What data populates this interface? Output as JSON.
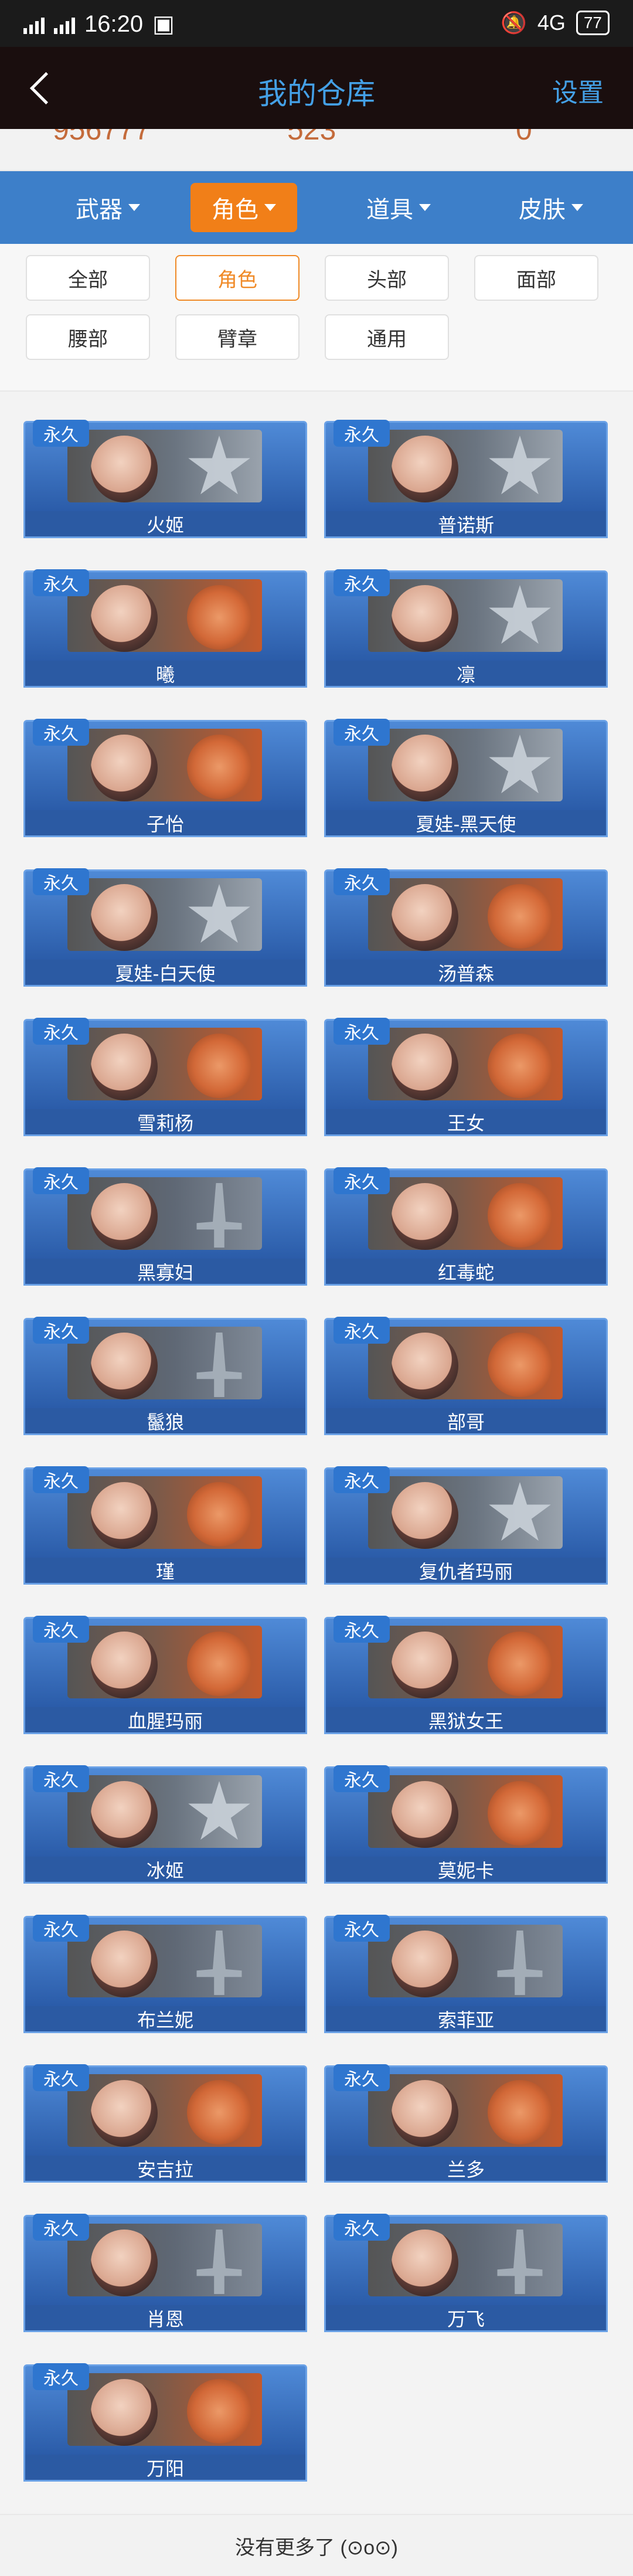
{
  "status": {
    "time": "16:20",
    "left_icons": [
      "signal-icon",
      "network-icon",
      "notification-icon"
    ],
    "right_text": "4G",
    "battery": "77"
  },
  "nav": {
    "title": "我的仓库",
    "settings": "设置"
  },
  "partial_header": {
    "values": [
      "956777",
      "523",
      "0"
    ]
  },
  "tabs": [
    {
      "label": "武器",
      "active": false
    },
    {
      "label": "角色",
      "active": true
    },
    {
      "label": "道具",
      "active": false
    },
    {
      "label": "皮肤",
      "active": false
    }
  ],
  "filters": [
    {
      "label": "全部",
      "active": false
    },
    {
      "label": "角色",
      "active": true
    },
    {
      "label": "头部",
      "active": false
    },
    {
      "label": "面部",
      "active": false
    },
    {
      "label": "腰部",
      "active": false
    },
    {
      "label": "臂章",
      "active": false
    },
    {
      "label": "通用",
      "active": false
    }
  ],
  "items": [
    {
      "badge": "永久",
      "name": "火姬",
      "symbol": "star"
    },
    {
      "badge": "永久",
      "name": "普诺斯",
      "symbol": "star"
    },
    {
      "badge": "永久",
      "name": "曦",
      "symbol": "fist"
    },
    {
      "badge": "永久",
      "name": "凛",
      "symbol": "star"
    },
    {
      "badge": "永久",
      "name": "子怡",
      "symbol": "fist"
    },
    {
      "badge": "永久",
      "name": "夏娃-黑天使",
      "symbol": "star"
    },
    {
      "badge": "永久",
      "name": "夏娃-白天使",
      "symbol": "star"
    },
    {
      "badge": "永久",
      "name": "汤普森",
      "symbol": "fist"
    },
    {
      "badge": "永久",
      "name": "雪莉杨",
      "symbol": "fist"
    },
    {
      "badge": "永久",
      "name": "王女",
      "symbol": "fist"
    },
    {
      "badge": "永久",
      "name": "黑寡妇",
      "symbol": "dagger"
    },
    {
      "badge": "永久",
      "name": "红毒蛇",
      "symbol": "fist"
    },
    {
      "badge": "永久",
      "name": "鬣狼",
      "symbol": "dagger"
    },
    {
      "badge": "永久",
      "name": "部哥",
      "symbol": "fist"
    },
    {
      "badge": "永久",
      "name": "瑾",
      "symbol": "fist"
    },
    {
      "badge": "永久",
      "name": "复仇者玛丽",
      "symbol": "star"
    },
    {
      "badge": "永久",
      "name": "血腥玛丽",
      "symbol": "fist"
    },
    {
      "badge": "永久",
      "name": "黑狱女王",
      "symbol": "fist"
    },
    {
      "badge": "永久",
      "name": "冰姬",
      "symbol": "star"
    },
    {
      "badge": "永久",
      "name": "莫妮卡",
      "symbol": "fist"
    },
    {
      "badge": "永久",
      "name": "布兰妮",
      "symbol": "dagger"
    },
    {
      "badge": "永久",
      "name": "索菲亚",
      "symbol": "dagger"
    },
    {
      "badge": "永久",
      "name": "安吉拉",
      "symbol": "fist"
    },
    {
      "badge": "永久",
      "name": "兰多",
      "symbol": "fist"
    },
    {
      "badge": "永久",
      "name": "肖恩",
      "symbol": "dagger"
    },
    {
      "badge": "永久",
      "name": "万飞",
      "symbol": "dagger"
    },
    {
      "badge": "永久",
      "name": "万阳",
      "symbol": "fist"
    }
  ],
  "footer": {
    "text": "没有更多了 (⊙o⊙)"
  },
  "colors": {
    "accent_blue": "#3d7fc9",
    "active_orange": "#f17f18",
    "title_blue": "#44a0e6"
  }
}
